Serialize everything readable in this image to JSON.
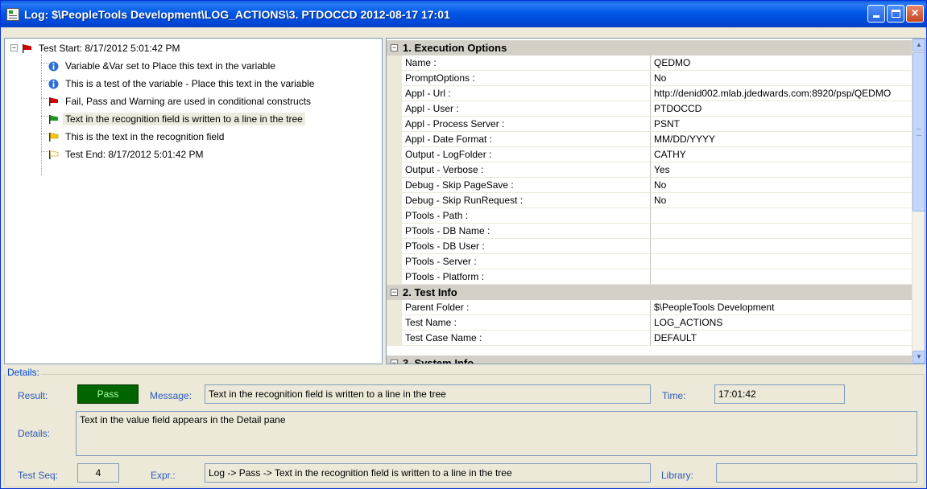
{
  "window": {
    "title": "Log: $\\PeopleTools Development\\LOG_ACTIONS\\3. PTDOCCD 2012-08-17 17:01",
    "buttons": [
      "minimize",
      "maximize",
      "close"
    ]
  },
  "tree": {
    "expander_glyph": "−",
    "root": {
      "label": "Test Start:  8/17/2012 5:01:42 PM",
      "icon": "red-flag-icon"
    },
    "items": [
      {
        "label": "Variable &Var set to Place this text in the variable",
        "icon": "info-icon"
      },
      {
        "label": "This is a test of the variable - Place this text in the variable",
        "icon": "info-icon"
      },
      {
        "label": "Fail, Pass and Warning are used in conditional constructs",
        "icon": "red-flag-icon"
      },
      {
        "label": "Text in the recognition field is written to a line in the tree",
        "icon": "green-flag-icon",
        "selected": true
      },
      {
        "label": "This is the text in the recognition field",
        "icon": "yellow-flag-icon"
      },
      {
        "label": "Test End:  8/17/2012 5:01:42 PM",
        "icon": "white-flag-icon"
      }
    ]
  },
  "grid": {
    "categories": [
      {
        "label": "1. Execution Options",
        "expander": "−",
        "rows": [
          {
            "name": "Name :",
            "value": "QEDMO"
          },
          {
            "name": "PromptOptions :",
            "value": "No"
          },
          {
            "name": "Appl - Url :",
            "value": "http://denid002.mlab.jdedwards.com:8920/psp/QEDMO"
          },
          {
            "name": "Appl - User :",
            "value": "PTDOCCD"
          },
          {
            "name": "Appl - Process Server :",
            "value": "PSNT"
          },
          {
            "name": "Appl - Date Format :",
            "value": "MM/DD/YYYY"
          },
          {
            "name": "Output - LogFolder :",
            "value": "CATHY"
          },
          {
            "name": "Output - Verbose :",
            "value": "Yes"
          },
          {
            "name": "Debug - Skip PageSave :",
            "value": "No"
          },
          {
            "name": "Debug - Skip RunRequest :",
            "value": "No"
          },
          {
            "name": "PTools - Path :",
            "value": ""
          },
          {
            "name": "PTools - DB Name :",
            "value": ""
          },
          {
            "name": "PTools - DB User :",
            "value": ""
          },
          {
            "name": "PTools - Server :",
            "value": ""
          },
          {
            "name": "PTools - Platform :",
            "value": ""
          }
        ]
      },
      {
        "label": "2. Test Info",
        "expander": "−",
        "rows": [
          {
            "name": "Parent Folder :",
            "value": "$\\PeopleTools Development"
          },
          {
            "name": "Test Name :",
            "value": "LOG_ACTIONS"
          },
          {
            "name": "Test Case Name :",
            "value": "DEFAULT"
          }
        ]
      },
      {
        "label": "3. System Info",
        "expander": "−",
        "rows": []
      }
    ]
  },
  "details": {
    "legend": "Details:",
    "result_label": "Result:",
    "result_value": "Pass",
    "message_label": "Message:",
    "message_value": "Text in the recognition field is written to a line in the tree",
    "time_label": "Time:",
    "time_value": "17:01:42",
    "details_label": "Details:",
    "details_value": "Text in the value field appears in the Detail pane",
    "testseq_label": "Test Seq:",
    "testseq_value": "4",
    "expr_label": "Expr.:",
    "expr_value": "Log -> Pass -> Text in the recognition field is written to a line in the tree",
    "library_label": "Library:",
    "library_value": ""
  },
  "colors": {
    "titlebar": "#0058e6",
    "pass_fill": "#006400",
    "label_blue": "#2d5ab8",
    "category_bg": "#d4d0c8"
  }
}
